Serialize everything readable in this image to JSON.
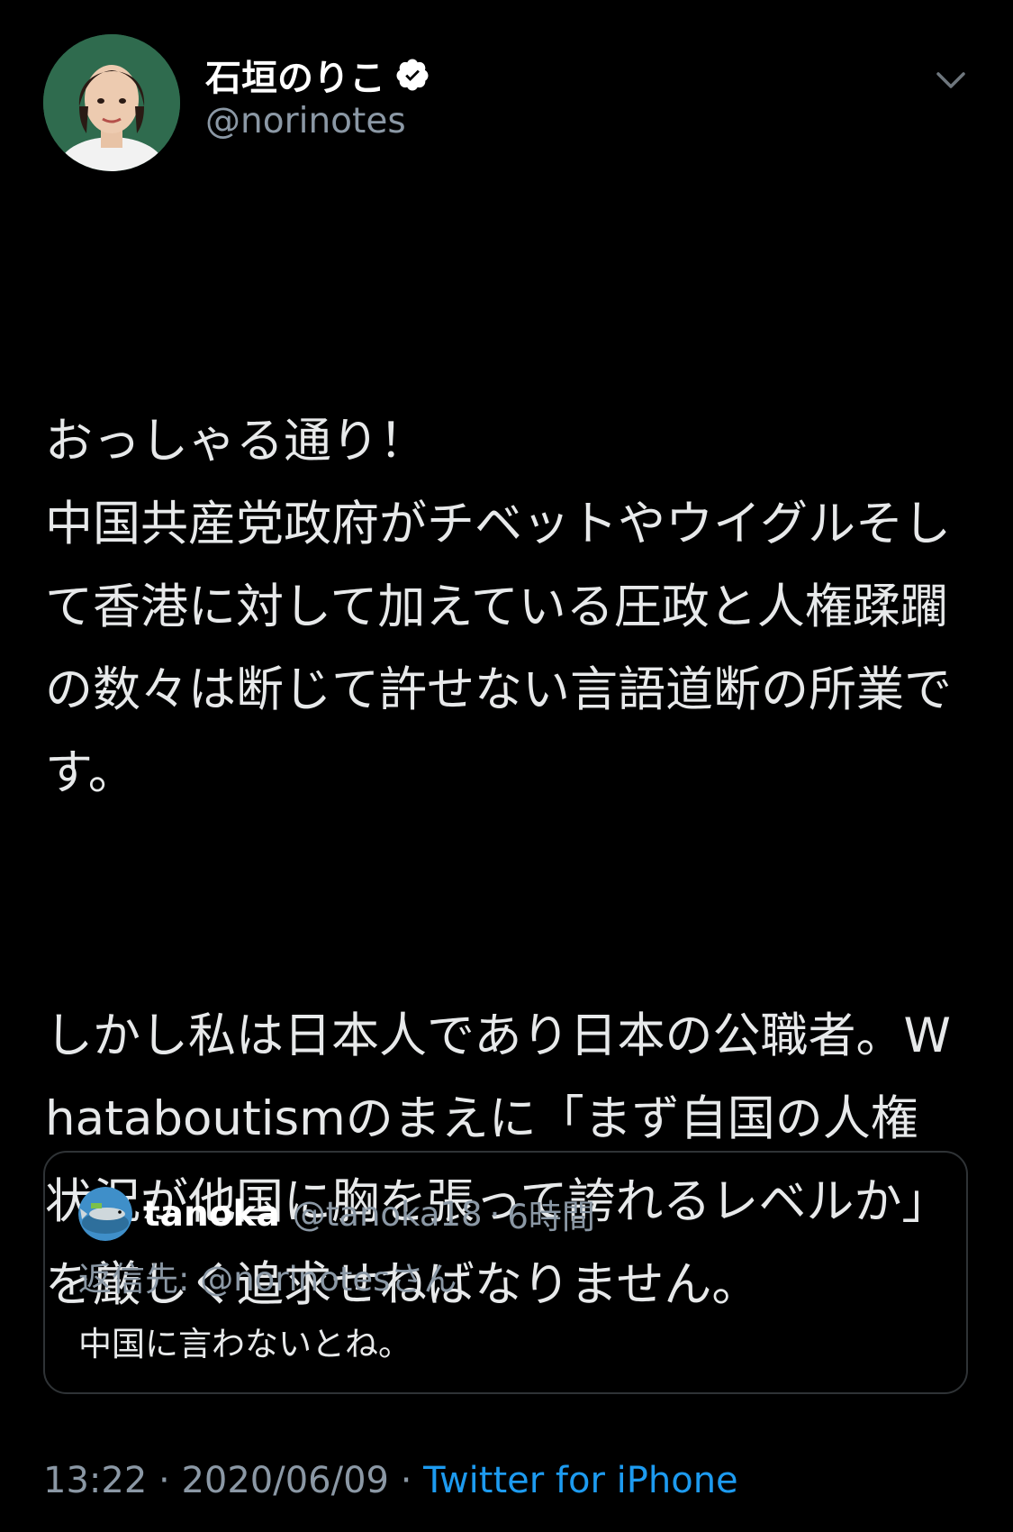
{
  "author": {
    "display_name": "石垣のりこ",
    "handle": "@norinotes",
    "verified": true
  },
  "tweet": {
    "paragraphs": [
      "おっしゃる通り！\n中国共産党政府がチベットやウイグルそして香港に対して加えている圧政と人権蹂躙の数々は断じて許せない言語道断の所業です。",
      "しかし私は日本人であり日本の公職者。Whataboutismのまえに「まず自国の人権状況が他国に胸を張って誇れるレベルか」を厳しく追求せねばなりません。"
    ]
  },
  "quoted_tweet": {
    "display_name": "tanoka",
    "handle": "@tanoka18",
    "separator": "·",
    "time": "6時間",
    "reply_to": "返信先: @norinotesさん",
    "text": "中国に言わないとね。"
  },
  "meta": {
    "time": "13:22",
    "sep1": " · ",
    "date": "2020/06/09",
    "sep2": " · ",
    "source": "Twitter for iPhone"
  },
  "icons": {
    "verified": "verified-badge-icon",
    "menu": "chevron-down-icon"
  },
  "colors": {
    "background": "#000000",
    "link": "#1d9bf0",
    "secondary_text": "#8b98a5",
    "primary_text": "#e7e9ea",
    "card_border": "#2f3336"
  }
}
